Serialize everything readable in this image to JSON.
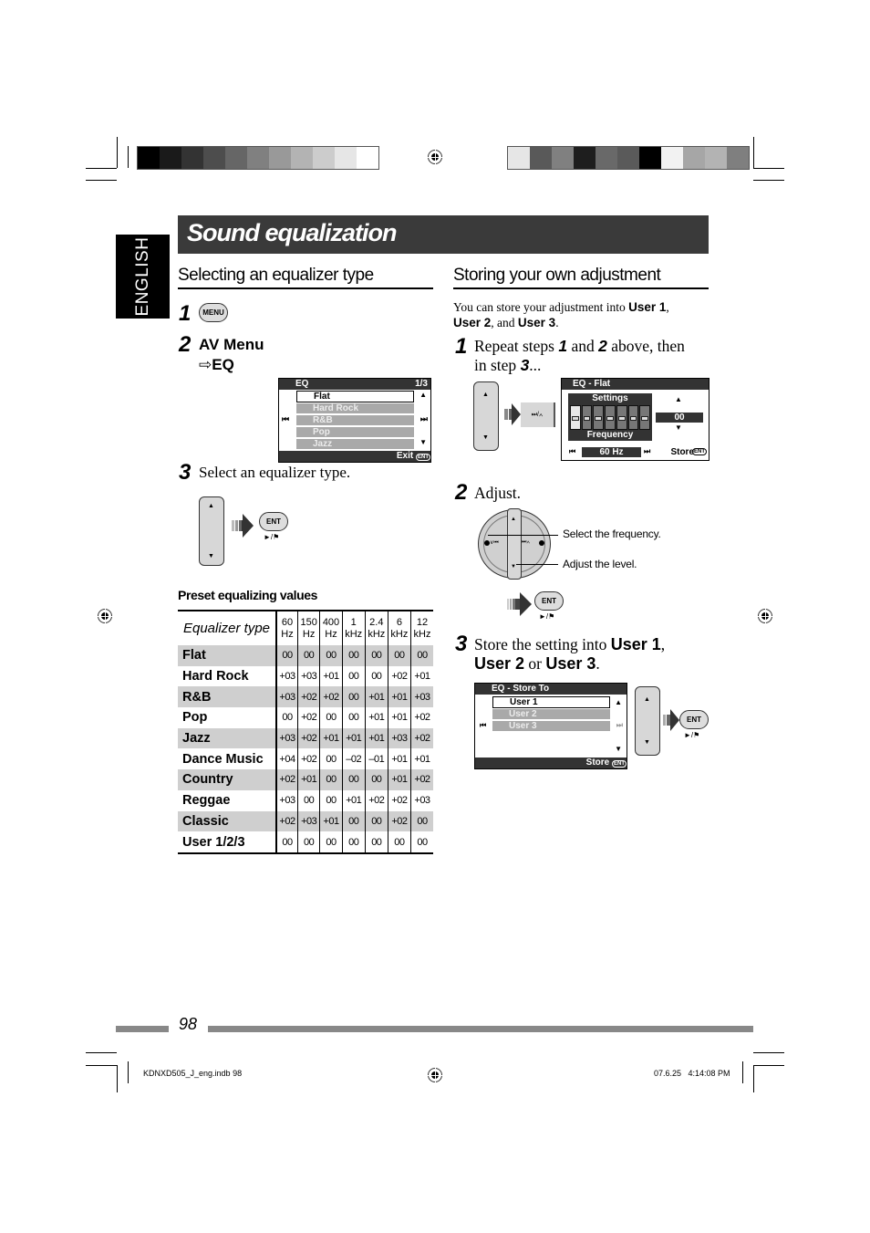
{
  "color_bars": {
    "left": [
      "#000000",
      "#1a1a1a",
      "#333333",
      "#4d4d4d",
      "#666666",
      "#808080",
      "#999999",
      "#b3b3b3",
      "#cccccc",
      "#e6e6e6",
      "#ffffff"
    ],
    "right": [
      "#e6e6e6",
      "#595959",
      "#808080",
      "#1e1e1e",
      "#696969",
      "#5a5a5a",
      "#000000",
      "#f2f2f2",
      "#a6a6a6",
      "#b3b3b3",
      "#7f7f7f"
    ]
  },
  "language_tab": "ENGLISH",
  "page_title": "Sound equalization",
  "left": {
    "heading": "Selecting an equalizer type",
    "step1": {
      "num": "1",
      "button": "MENU"
    },
    "step2": {
      "num": "2",
      "line1": "AV Menu",
      "arrow": "⇨",
      "line2": "EQ"
    },
    "eq_screen": {
      "header": "EQ",
      "page": "1/3",
      "items": [
        {
          "label": "Flat",
          "selected": true
        },
        {
          "label": "Hard Rock",
          "selected": false
        },
        {
          "label": "R&B",
          "selected": false
        },
        {
          "label": "Pop",
          "selected": false
        },
        {
          "label": "Jazz",
          "selected": false
        }
      ],
      "prev_icon": "⏮",
      "next_icon": "⏭",
      "up_icon": "▲",
      "down_icon": "▼",
      "footer": "Exit",
      "footer_badge": "ENT"
    },
    "step3": {
      "num": "3",
      "text": "Select an equalizer type.",
      "button": "ENT",
      "sub": "►/⚑"
    },
    "preset_title": "Preset equalizing values",
    "table": {
      "type_header": "Equalizer type",
      "columns": [
        {
          "top": "60",
          "bottom": "Hz"
        },
        {
          "top": "150",
          "bottom": "Hz"
        },
        {
          "top": "400",
          "bottom": "Hz"
        },
        {
          "top": "1",
          "bottom": "kHz"
        },
        {
          "top": "2.4",
          "bottom": "kHz"
        },
        {
          "top": "6",
          "bottom": "kHz"
        },
        {
          "top": "12",
          "bottom": "kHz"
        }
      ],
      "rows": [
        {
          "name": "Flat",
          "values": [
            "00",
            "00",
            "00",
            "00",
            "00",
            "00",
            "00"
          ]
        },
        {
          "name": "Hard Rock",
          "values": [
            "+03",
            "+03",
            "+01",
            "00",
            "00",
            "+02",
            "+01"
          ]
        },
        {
          "name": "R&B",
          "values": [
            "+03",
            "+02",
            "+02",
            "00",
            "+01",
            "+01",
            "+03"
          ]
        },
        {
          "name": "Pop",
          "values": [
            "00",
            "+02",
            "00",
            "00",
            "+01",
            "+01",
            "+02"
          ]
        },
        {
          "name": "Jazz",
          "values": [
            "+03",
            "+02",
            "+01",
            "+01",
            "+01",
            "+03",
            "+02"
          ]
        },
        {
          "name": "Dance Music",
          "values": [
            "+04",
            "+02",
            "00",
            "–02",
            "–01",
            "+01",
            "+01"
          ]
        },
        {
          "name": "Country",
          "values": [
            "+02",
            "+01",
            "00",
            "00",
            "00",
            "+01",
            "+02"
          ]
        },
        {
          "name": "Reggae",
          "values": [
            "+03",
            "00",
            "00",
            "+01",
            "+02",
            "+02",
            "+03"
          ]
        },
        {
          "name": "Classic",
          "values": [
            "+02",
            "+03",
            "+01",
            "00",
            "00",
            "+02",
            "00"
          ]
        },
        {
          "name": "User 1/2/3",
          "values": [
            "00",
            "00",
            "00",
            "00",
            "00",
            "00",
            "00"
          ]
        }
      ]
    }
  },
  "right": {
    "heading": "Storing your own adjustment",
    "intro": {
      "pre": "You can store your adjustment into ",
      "u1": "User 1",
      "sep1": ",",
      "u2": "User 2",
      "sep2": ", and ",
      "u3": "User 3",
      "end": "."
    },
    "step1": {
      "num": "1",
      "t1": "Repeat steps ",
      "s1": "1",
      "t2": " and ",
      "s2": "2",
      "t3": " above, then",
      "t4": "in step ",
      "s3": "3",
      "t5": "..."
    },
    "button_skip": "⏭/∧",
    "eq_flat_screen": {
      "header": "EQ - Flat",
      "settings": "Settings",
      "frequency": "Frequency",
      "value": "00",
      "freq_value": "60 Hz",
      "store": "Store",
      "store_badge": "ENT",
      "prev_icon": "⏮",
      "next_icon": "⏭"
    },
    "step2": {
      "num": "2",
      "text": "Adjust.",
      "callout1": "Select the frequency.",
      "callout2": "Adjust the level.",
      "left_label": "∨⏮",
      "right_label": "⏭∧",
      "button": "ENT",
      "sub": "►/⚑"
    },
    "step3": {
      "num": "3",
      "t1": "Store the setting into ",
      "u1": "User 1",
      "c": ",",
      "u2": "User 2",
      "or": " or ",
      "u3": "User 3",
      "end": "."
    },
    "store_screen": {
      "header": "EQ - Store To",
      "items": [
        {
          "label": "User 1",
          "selected": true
        },
        {
          "label": "User 2",
          "selected": false
        },
        {
          "label": "User 3",
          "selected": false
        }
      ],
      "footer": "Store",
      "footer_badge": "ENT",
      "button": "ENT",
      "sub": "►/⚑"
    }
  },
  "page_number": "98",
  "footer_left": "KDNXD505_J_eng.indb   98",
  "footer_right": "07.6.25   4:14:08 PM"
}
